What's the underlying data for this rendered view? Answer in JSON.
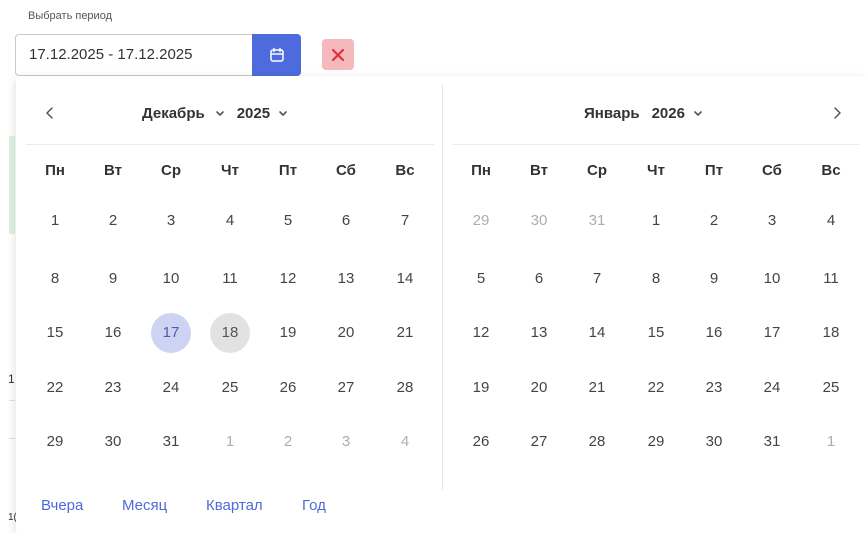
{
  "filter": {
    "label": "Выбрать период",
    "value": "17.12.2025 - 17.12.2025"
  },
  "icons": {
    "calendar": "calendar-icon",
    "clear": "close-icon",
    "prev": "chevron-left-icon",
    "next": "chevron-right-icon",
    "dropdown": "chevron-down-icon"
  },
  "colors": {
    "accent": "#4d6bdc",
    "clear_bg": "#f4b8bd",
    "clear_icon": "#e0323c",
    "selected_start": "#cdd3f3",
    "selected_end": "#e2e2e2"
  },
  "weekdays": [
    "Пн",
    "Вт",
    "Ср",
    "Чт",
    "Пт",
    "Сб",
    "Вс"
  ],
  "left_calendar": {
    "month": "Декабрь",
    "year": "2025",
    "days": [
      [
        "1",
        "2",
        "3",
        "4",
        "5",
        "6",
        "7"
      ],
      [
        "8",
        "9",
        "10",
        "11",
        "12",
        "13",
        "14"
      ],
      [
        "15",
        "16",
        "17",
        "18",
        "19",
        "20",
        "21"
      ],
      [
        "22",
        "23",
        "24",
        "25",
        "26",
        "27",
        "28"
      ],
      [
        "29",
        "30",
        "31",
        "1",
        "2",
        "3",
        "4"
      ]
    ]
  },
  "right_calendar": {
    "month": "Январь",
    "year": "2026",
    "days": [
      [
        "29",
        "30",
        "31",
        "1",
        "2",
        "3",
        "4"
      ],
      [
        "5",
        "6",
        "7",
        "8",
        "9",
        "10",
        "11"
      ],
      [
        "12",
        "13",
        "14",
        "15",
        "16",
        "17",
        "18"
      ],
      [
        "19",
        "20",
        "21",
        "22",
        "23",
        "24",
        "25"
      ],
      [
        "26",
        "27",
        "28",
        "29",
        "30",
        "31",
        "1"
      ]
    ]
  },
  "presets": [
    "Вчера",
    "Месяц",
    "Квартал",
    "Год"
  ],
  "background_fragments": [
    "1",
    "1("
  ]
}
